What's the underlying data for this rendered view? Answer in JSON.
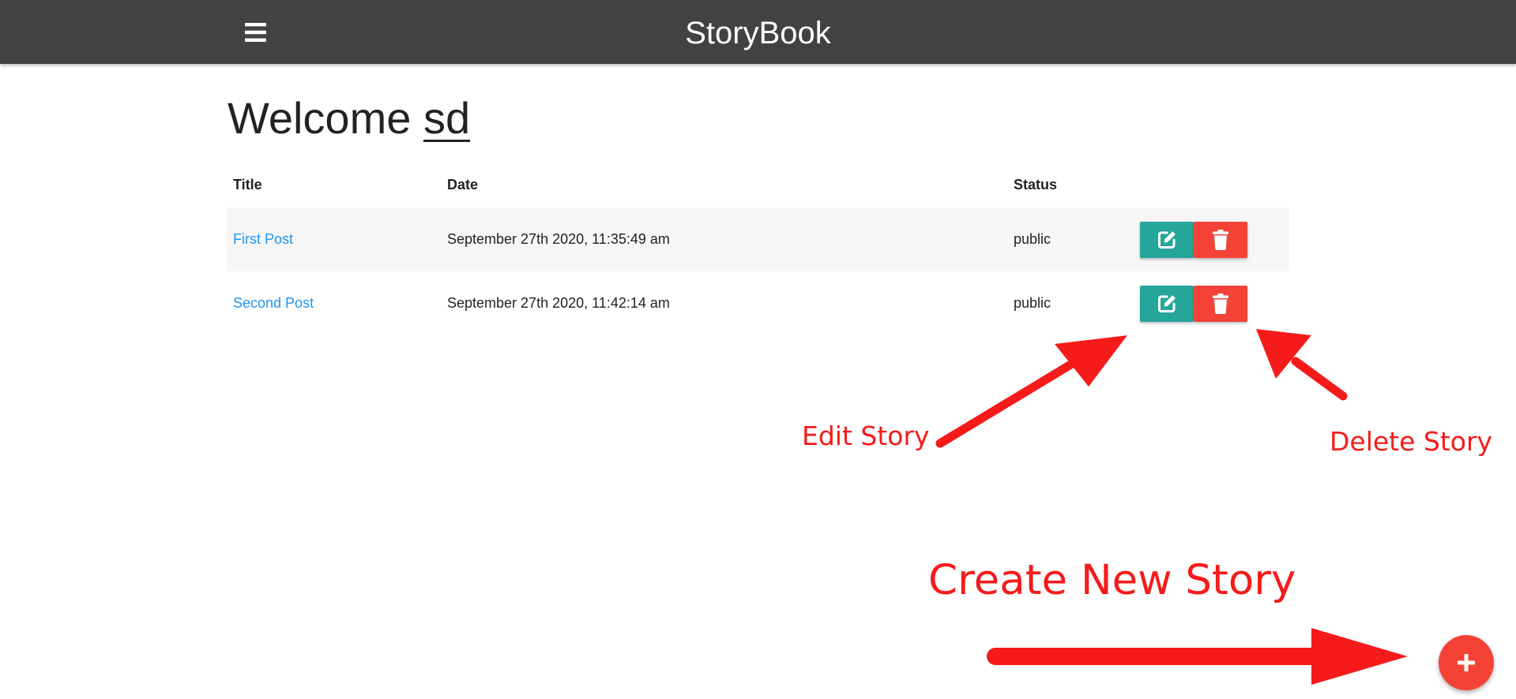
{
  "navbar": {
    "brand": "StoryBook",
    "menu_icon": "hamburger-menu-icon",
    "background": "#424242"
  },
  "welcome": {
    "prefix": "Welcome ",
    "user": "sd"
  },
  "table": {
    "headers": {
      "title": "Title",
      "date": "Date",
      "status": "Status"
    },
    "rows": [
      {
        "title": "First Post",
        "date": "September 27th 2020, 11:35:49 am",
        "status": "public"
      },
      {
        "title": "Second Post",
        "date": "September 27th 2020, 11:42:14 am",
        "status": "public"
      }
    ],
    "edit_icon": "edit-icon",
    "delete_icon": "trash-icon"
  },
  "annotations": {
    "edit": "Edit Story",
    "delete": "Delete Story",
    "create": "Create New Story",
    "color": "#f51b1b"
  },
  "fab": {
    "icon": "plus-icon"
  },
  "colors": {
    "link": "#2196f3",
    "edit_button": "#26a69a",
    "delete_button": "#f44336",
    "fab": "#f44336"
  }
}
